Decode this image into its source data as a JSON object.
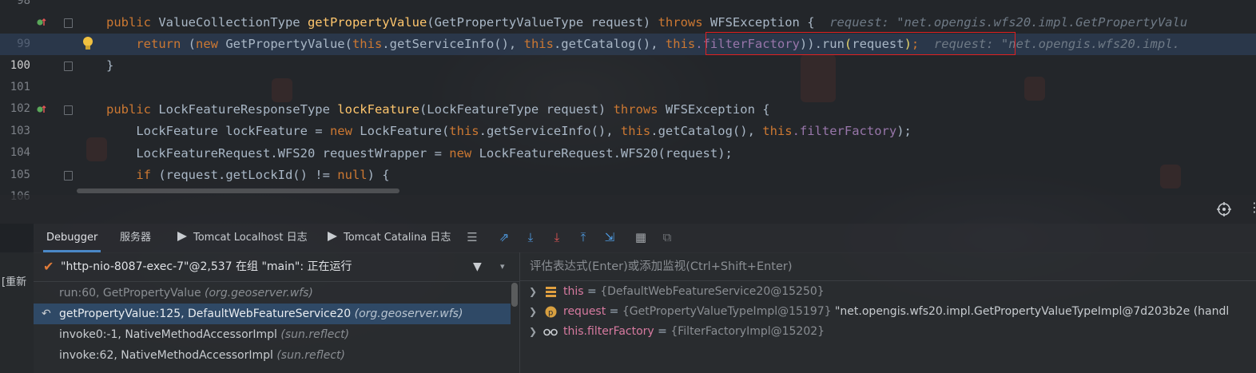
{
  "editor": {
    "lines": [
      {
        "num": "98"
      },
      {
        "num": "99"
      },
      {
        "num": "100"
      },
      {
        "num": "101"
      },
      {
        "num": "102"
      },
      {
        "num": "103"
      },
      {
        "num": "104"
      },
      {
        "num": "105"
      },
      {
        "num": "106"
      }
    ],
    "code": {
      "l99_a": "public ",
      "l99_b": "ValueCollectionType ",
      "l99_c": "getPropertyValue",
      "l99_d": "(GetPropertyValueType request) ",
      "l99_e": "throws ",
      "l99_f": "WFSException {",
      "l99_hint": "  request: \"net.opengis.wfs20.impl.GetPropertyValu",
      "l100_a": "    return ",
      "l100_b": "(",
      "l100_c": "new ",
      "l100_d": "GetPropertyValue(",
      "l100_e": "this",
      "l100_f": ".getServiceInfo(), ",
      "l100_g": "this",
      "l100_h": ".getCatalog(), ",
      "l100_i": "this",
      "l100_j": ".filterFactory",
      "l100_k": ")).run",
      "l100_l": "(",
      "l100_m": "request",
      "l100_n": ")",
      "l100_o": ";",
      "l100_hint": "  request: \"net.opengis.wfs20.impl.",
      "l101": "}",
      "l103_a": "public ",
      "l103_b": "LockFeatureResponseType ",
      "l103_c": "lockFeature",
      "l103_d": "(LockFeatureType request) ",
      "l103_e": "throws ",
      "l103_f": "WFSException {",
      "l104_a": "    LockFeature lockFeature = ",
      "l104_b": "new ",
      "l104_c": "LockFeature(",
      "l104_d": "this",
      "l104_e": ".getServiceInfo(), ",
      "l104_f": "this",
      "l104_g": ".getCatalog(), ",
      "l104_h": "this",
      "l104_i": ".filterFactory",
      "l104_j": ");",
      "l105_a": "    LockFeatureRequest.WFS20 requestWrapper = ",
      "l105_b": "new ",
      "l105_c": "LockFeatureRequest.WFS20(request);",
      "l106_a": "    if ",
      "l106_b": "(request.getLockId() != ",
      "l106_c": "null",
      "l106_d": ") {"
    }
  },
  "debugger": {
    "tabs": [
      {
        "label": "Debugger"
      },
      {
        "label": "服务器"
      },
      {
        "label": "Tomcat Localhost 日志"
      },
      {
        "label": "Tomcat Catalina 日志"
      }
    ],
    "left_edge_label": "[重新",
    "thread_label": "\"http-nio-8087-exec-7\"@2,537 在组 \"main\": 正在运行",
    "frames": [
      {
        "method": "run:60, GetPropertyValue ",
        "pkg": "(org.geoserver.wfs)"
      },
      {
        "method": "getPropertyValue:125, DefaultWebFeatureService20 ",
        "pkg": "(org.geoserver.wfs)"
      },
      {
        "method": "invoke0:-1, NativeMethodAccessorImpl ",
        "pkg": "(sun.reflect)"
      },
      {
        "method": "invoke:62, NativeMethodAccessorImpl ",
        "pkg": "(sun.reflect)"
      }
    ],
    "watch_placeholder": "评估表达式(Enter)或添加监视(Ctrl+Shift+Enter)",
    "variables": [
      {
        "name": "this",
        "eq": " = ",
        "type": "{DefaultWebFeatureService20@15250}",
        "value": ""
      },
      {
        "name": "request",
        "eq": " = ",
        "type": "{GetPropertyValueTypeImpl@15197}",
        "value": " \"net.opengis.wfs20.impl.GetPropertyValueTypeImpl@7d203b2e (handl"
      },
      {
        "name": "this.filterFactory",
        "eq": " = ",
        "type": "{FilterFactoryImpl@15202}",
        "value": ""
      }
    ]
  },
  "colors": {
    "accent": "#4a88c7",
    "highlight_box": "#e02020",
    "keyword": "#cc7832",
    "method": "#ffc66d",
    "field": "#9876aa"
  }
}
